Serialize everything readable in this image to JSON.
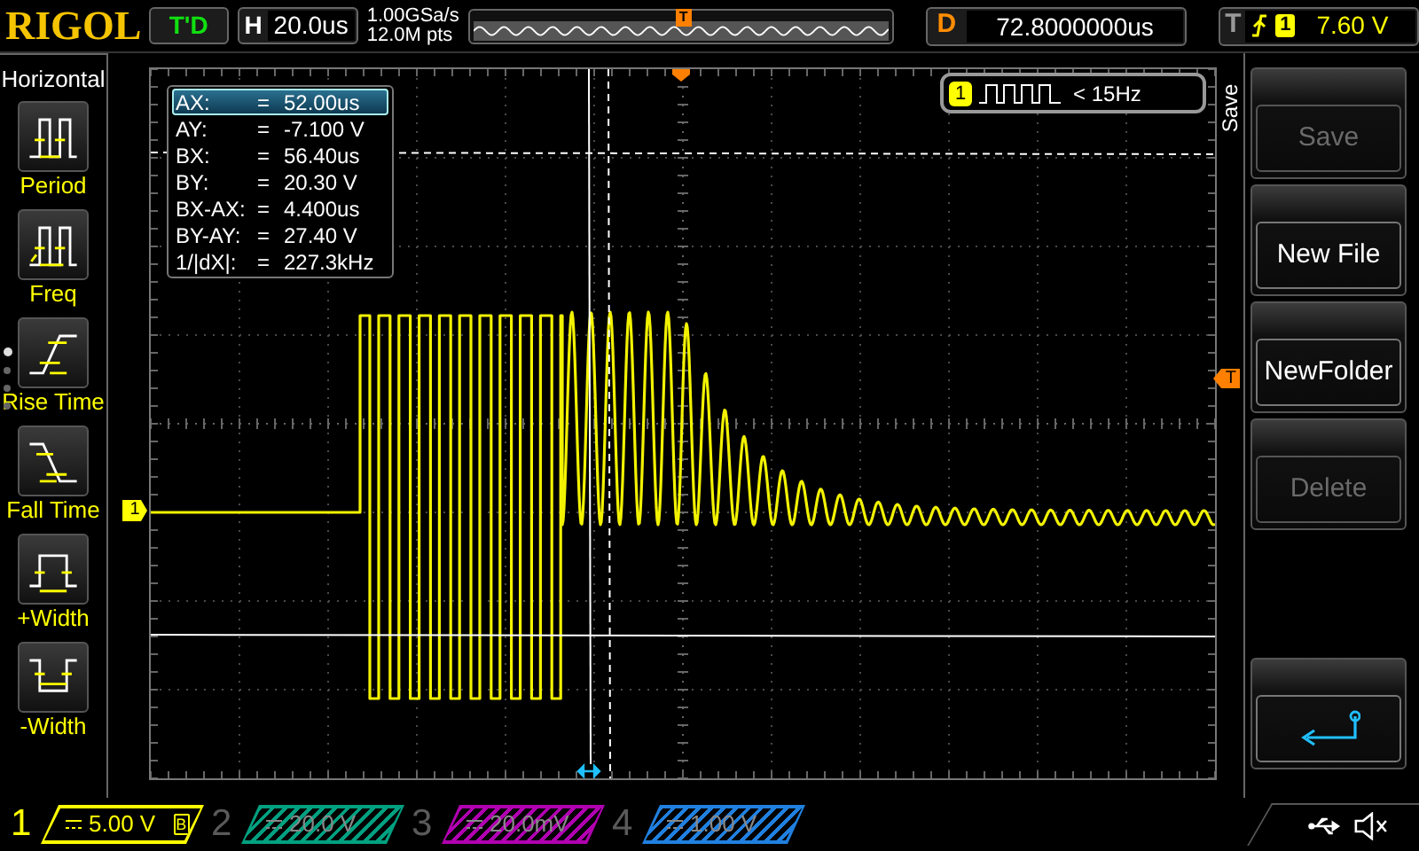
{
  "header": {
    "logo": "RIGOL",
    "run_status": "T'D",
    "timebase": {
      "label": "H",
      "value": "20.0us"
    },
    "sample_rate": "1.00GSa/s",
    "memory_depth": "12.0M pts",
    "preview_marker": "T",
    "delay": {
      "label": "D",
      "value": "72.8000000us"
    },
    "trigger": {
      "label": "T",
      "source": "1",
      "level": "7.60 V"
    }
  },
  "sidebar": {
    "title": "Horizontal",
    "page_dots": [
      {
        "selected": true
      },
      {
        "selected": false
      },
      {
        "selected": false
      },
      {
        "selected": false
      }
    ],
    "items": [
      {
        "kind": "period",
        "label": "Period"
      },
      {
        "kind": "freq",
        "label": "Freq"
      },
      {
        "kind": "rise",
        "label": "Rise Time"
      },
      {
        "kind": "fall",
        "label": "Fall Time"
      },
      {
        "kind": "pwidth",
        "label": "+Width"
      },
      {
        "kind": "nwidth",
        "label": "-Width"
      }
    ]
  },
  "cursor_readout": [
    {
      "label": "AX:",
      "sign": "=",
      "value": "52.00us",
      "selected": true
    },
    {
      "label": "AY:",
      "sign": "=",
      "value": "-7.100 V",
      "selected": false
    },
    {
      "label": "BX:",
      "sign": "=",
      "value": "56.40us",
      "selected": false
    },
    {
      "label": "BY:",
      "sign": "=",
      "value": "20.30 V",
      "selected": false
    },
    {
      "label": "BX-AX:",
      "sign": "=",
      "value": "4.400us",
      "selected": false
    },
    {
      "label": "BY-AY:",
      "sign": "=",
      "value": "27.40 V",
      "selected": false
    },
    {
      "label": "1/|dX|:",
      "sign": "=",
      "value": "227.3kHz",
      "selected": false
    }
  ],
  "frequency_counter": {
    "channel": "1",
    "reading": "< 15Hz"
  },
  "channel_marker": "1",
  "trigger_marker": "T",
  "menu": {
    "title": "Save",
    "buttons": [
      {
        "label": "Save",
        "disabled": true
      },
      {
        "label": "New File",
        "disabled": false
      },
      {
        "label": "NewFolder",
        "disabled": false
      },
      {
        "label": "Delete",
        "disabled": true
      }
    ]
  },
  "channels": [
    {
      "number": "1",
      "scale": "5.00 V",
      "on": true,
      "color": "#ffff00",
      "bw_limit": "B"
    },
    {
      "number": "2",
      "scale": "20.0 V",
      "on": false,
      "color": "#00a080"
    },
    {
      "number": "3",
      "scale": "20.0mV",
      "on": false,
      "color": "#b000b0"
    },
    {
      "number": "4",
      "scale": "1.00 V",
      "on": false,
      "color": "#2080e0"
    }
  ]
}
